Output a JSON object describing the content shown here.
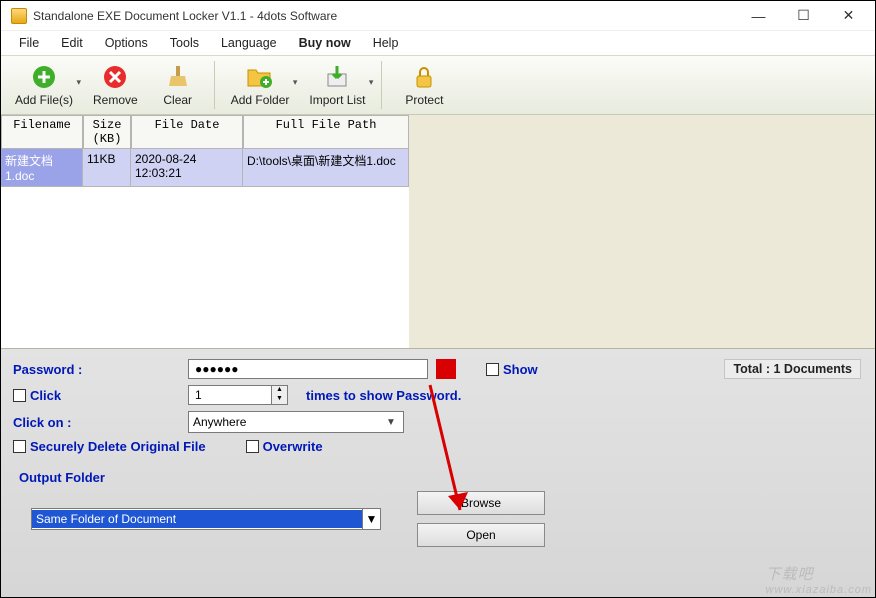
{
  "window": {
    "title": "Standalone EXE Document Locker V1.1 - 4dots Software"
  },
  "menu": {
    "items": [
      "File",
      "Edit",
      "Options",
      "Tools",
      "Language",
      "Buy now",
      "Help"
    ]
  },
  "toolbar": {
    "add_files": "Add File(s)",
    "remove": "Remove",
    "clear": "Clear",
    "add_folder": "Add Folder",
    "import_list": "Import List",
    "protect": "Protect"
  },
  "grid": {
    "headers": {
      "filename": "Filename",
      "size": "Size (KB)",
      "date": "File Date",
      "path": "Full File Path"
    },
    "rows": [
      {
        "filename": "新建文档1.doc",
        "size": "11KB",
        "date": "2020-08-24 12:03:21",
        "path": "D:\\tools\\桌面\\新建文档1.doc"
      }
    ]
  },
  "panel": {
    "password_label": "Password :",
    "password_value": "●●●●●●",
    "show_label": "Show",
    "click_label": "Click",
    "times_value": "1",
    "times_suffix": "times to show Password.",
    "click_on_label": "Click on :",
    "click_on_value": "Anywhere",
    "secure_delete_label": "Securely Delete Original File",
    "overwrite_label": "Overwrite",
    "output_folder_label": "Output Folder",
    "output_folder_value": "Same Folder of Document",
    "browse_label": "Browse",
    "open_label": "Open",
    "total_label": "Total : 1 Documents"
  },
  "watermark": {
    "top": "下载吧",
    "bottom": "www.xiazaiba.com"
  }
}
